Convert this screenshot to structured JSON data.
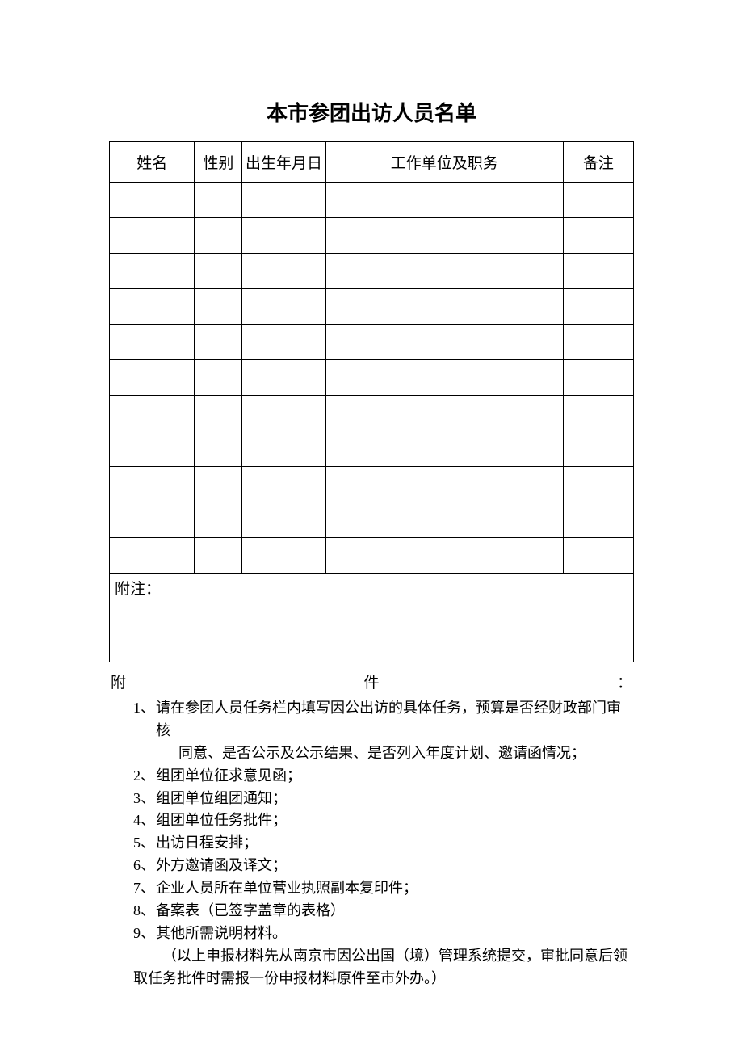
{
  "title": "本市参团出访人员名单",
  "table": {
    "headers": {
      "name": "姓名",
      "sex": "性别",
      "dob": "出生年月日",
      "unit": "工作单位及职务",
      "note": "备注"
    },
    "rows": [
      {
        "name": "",
        "sex": "",
        "dob": "",
        "unit": "",
        "note": ""
      },
      {
        "name": "",
        "sex": "",
        "dob": "",
        "unit": "",
        "note": ""
      },
      {
        "name": "",
        "sex": "",
        "dob": "",
        "unit": "",
        "note": ""
      },
      {
        "name": "",
        "sex": "",
        "dob": "",
        "unit": "",
        "note": ""
      },
      {
        "name": "",
        "sex": "",
        "dob": "",
        "unit": "",
        "note": ""
      },
      {
        "name": "",
        "sex": "",
        "dob": "",
        "unit": "",
        "note": ""
      },
      {
        "name": "",
        "sex": "",
        "dob": "",
        "unit": "",
        "note": ""
      },
      {
        "name": "",
        "sex": "",
        "dob": "",
        "unit": "",
        "note": ""
      },
      {
        "name": "",
        "sex": "",
        "dob": "",
        "unit": "",
        "note": ""
      },
      {
        "name": "",
        "sex": "",
        "dob": "",
        "unit": "",
        "note": ""
      },
      {
        "name": "",
        "sex": "",
        "dob": "",
        "unit": "",
        "note": ""
      }
    ],
    "footnote_label": "附注："
  },
  "attachments": {
    "heading_left": "附",
    "heading_mid": "件",
    "heading_right": "：",
    "items": [
      {
        "num": "1、",
        "text": "请在参团人员任务栏内填写因公出访的具体任务，预算是否经财政部门审核",
        "sub": "同意、是否公示及公示结果、是否列入年度计划、邀请函情况；"
      },
      {
        "num": "2、",
        "text": "组团单位征求意见函；"
      },
      {
        "num": "3、",
        "text": "组团单位组团通知；"
      },
      {
        "num": "4、",
        "text": "组团单位任务批件；"
      },
      {
        "num": "5、",
        "text": "出访日程安排；"
      },
      {
        "num": "6、",
        "text": "外方邀请函及译文；"
      },
      {
        "num": "7、",
        "text": "企业人员所在单位营业执照副本复印件；"
      },
      {
        "num": "8、",
        "text": "备案表（已签字盖章的表格）"
      },
      {
        "num": "9、",
        "text": "其他所需说明材料。"
      }
    ],
    "tail": "（以上申报材料先从南京市因公出国（境）管理系统提交，审批同意后领取任务批件时需报一份申报材料原件至市外办。）"
  }
}
